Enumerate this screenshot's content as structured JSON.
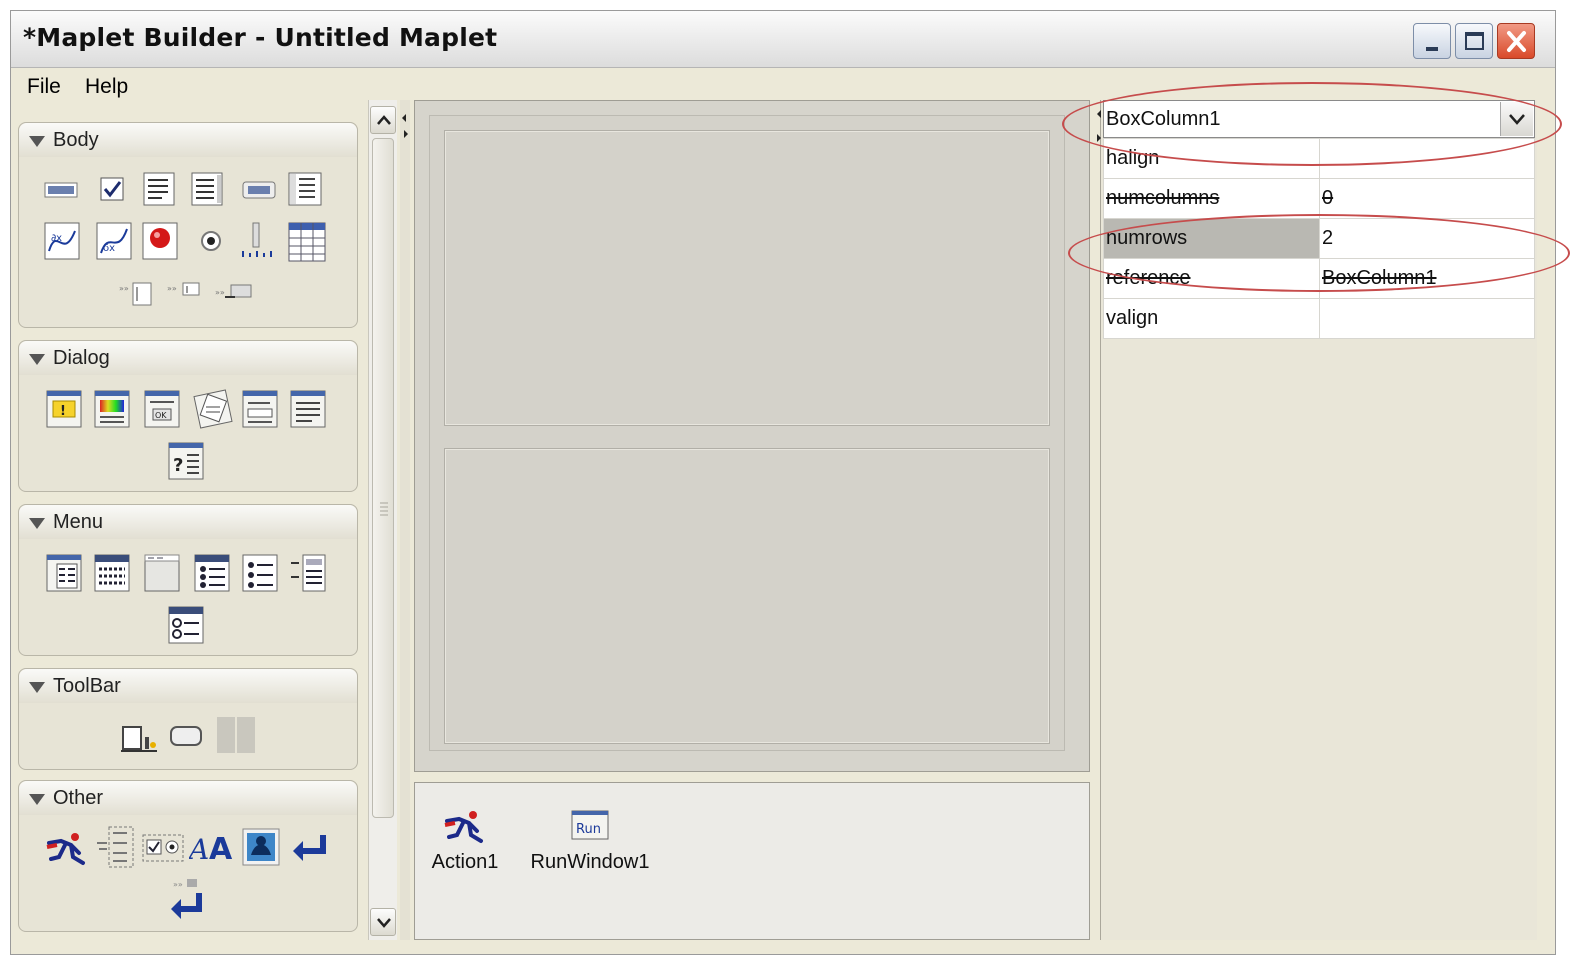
{
  "window": {
    "title": "*Maplet Builder - Untitled Maplet"
  },
  "menubar": {
    "items": [
      "File",
      "Help"
    ]
  },
  "palette": {
    "groups": [
      {
        "title": "Body",
        "icons": [
          "text-field-icon",
          "checkbox-icon",
          "text-box-icon",
          "math-field-icon",
          "button-icon",
          "list-box-icon",
          "plotter-icon",
          "math-plotter-icon",
          "color-dot-icon",
          "radio-button-icon",
          "slider-icon",
          "table-icon",
          "label-field-icon",
          "small-field-icon",
          "combo-box-icon"
        ]
      },
      {
        "title": "Dialog",
        "icons": [
          "alert-dialog-icon",
          "color-dialog-icon",
          "confirm-dialog-icon",
          "file-dialog-icon",
          "input-dialog-icon",
          "message-dialog-icon",
          "question-dialog-icon"
        ]
      },
      {
        "title": "Menu",
        "icons": [
          "menu-checkbox-icon",
          "menu-item-list-icon",
          "menu-bar-icon",
          "menu-radio-icon",
          "popup-menu-icon",
          "menu-separator-icon",
          "radio-menu-item-icon"
        ]
      },
      {
        "title": "ToolBar",
        "icons": [
          "toolbar-button-icon",
          "toolbar-rounded-icon",
          "toolbar-separator-icon"
        ]
      },
      {
        "title": "Other",
        "icons": [
          "action-icon",
          "box-layout-icon",
          "checkbox-group-icon",
          "font-icon",
          "image-icon",
          "return-icon",
          "return-values-icon"
        ]
      }
    ]
  },
  "nonvisual": {
    "items": [
      {
        "label": "Action1",
        "icon": "action-icon"
      },
      {
        "label": "RunWindow1",
        "icon": "run-window-icon",
        "badge": "Run"
      }
    ]
  },
  "properties": {
    "selected": "BoxColumn1",
    "rows": [
      {
        "key": "halign",
        "value": ""
      },
      {
        "key": "numcolumns",
        "value": "0"
      },
      {
        "key": "numrows",
        "value": "2"
      },
      {
        "key": "reference",
        "value": "BoxColumn1"
      },
      {
        "key": "valign",
        "value": ""
      }
    ]
  },
  "colors": {
    "annotation": "#c64c4c",
    "close_button": "#d94a2a"
  }
}
